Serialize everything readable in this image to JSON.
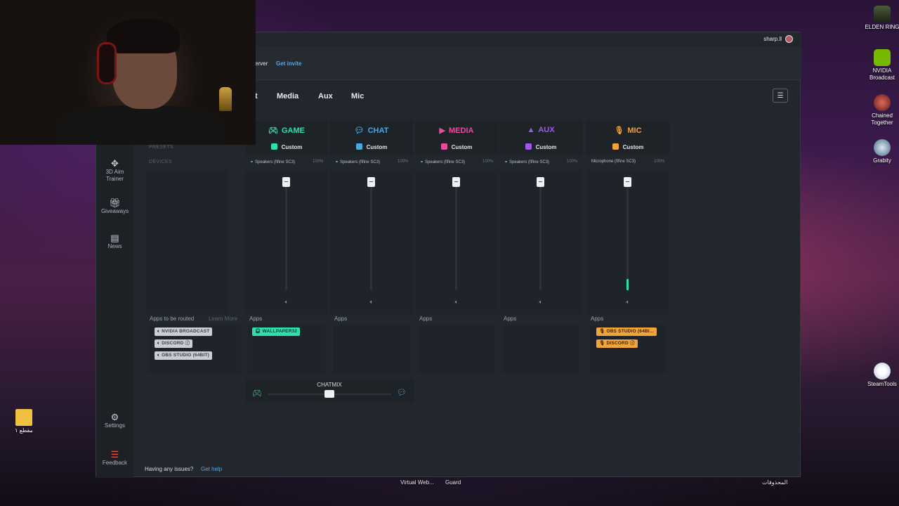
{
  "window": {
    "user": "sharp.ll",
    "invite_text": "erver",
    "invite_link": "Get invite",
    "tabs": [
      "t",
      "Media",
      "Aux",
      "Mic"
    ],
    "menu_icon": "hamburger-icon"
  },
  "sidebar": {
    "items": [
      {
        "label": "3D Aim\nTrainer",
        "icon": "aim-icon"
      },
      {
        "label": "Giveaways",
        "icon": "gift-icon"
      },
      {
        "label": "News",
        "icon": "news-icon"
      },
      {
        "label": "Settings",
        "icon": "gear-icon"
      },
      {
        "label": "Feedback",
        "icon": "feedback-icon"
      }
    ]
  },
  "left_column": {
    "presets_label": "PRESETS",
    "devices_label": "DEVICES",
    "apps_label": "Apps to be routed",
    "learn_more": "Learn More",
    "apps": [
      "NVIDIA BROADCAST",
      "DISCORD",
      "OBS STUDIO (64BIT)"
    ]
  },
  "channels": [
    {
      "name": "GAME",
      "color": "#2ee0b0",
      "preset": "Custom",
      "device": "Speakers (fifine SC3)",
      "volume": "100%",
      "apps_label": "Apps",
      "apps": [
        "WALLPAPER32"
      ],
      "fader_level": 1.0,
      "meter_level": 0
    },
    {
      "name": "CHAT",
      "color": "#47a9e8",
      "preset": "Custom",
      "device": "Speakers (fifine SC3)",
      "volume": "100%",
      "apps_label": "Apps",
      "apps": [],
      "fader_level": 1.0,
      "meter_level": 0
    },
    {
      "name": "MEDIA",
      "color": "#ec4a9c",
      "preset": "Custom",
      "device": "Speakers (fifine SC3)",
      "volume": "100%",
      "apps_label": "Apps",
      "apps": [],
      "fader_level": 1.0,
      "meter_level": 0
    },
    {
      "name": "AUX",
      "color": "#9c5ae8",
      "preset": "Custom",
      "device": "Speakers (fifine SC3)",
      "volume": "100%",
      "apps_label": "Apps",
      "apps": [],
      "fader_level": 1.0,
      "meter_level": 0
    },
    {
      "name": "MIC",
      "color": "#f2a33a",
      "preset": "Custom",
      "device": "Microphone (fifine SC3)",
      "volume": "100%",
      "apps_label": "Apps",
      "apps": [
        "OBS STUDIO (64BI...",
        "DISCORD"
      ],
      "fader_level": 1.0,
      "meter_level": 0.1
    }
  ],
  "chatmix": {
    "label": "CHATMIX",
    "position": 0.5
  },
  "footer": {
    "help_text": "Having any issues?",
    "help_link": "Get help"
  },
  "desktop": {
    "icons": [
      "ELDEN RING",
      "NVIDIA\nBroadcast",
      "Chained\nTogether",
      "Grabity",
      "SteamTools",
      "مقطع ١"
    ],
    "taskbar": [
      "Virtual Web...",
      "Guard",
      "المحذوفات"
    ]
  }
}
